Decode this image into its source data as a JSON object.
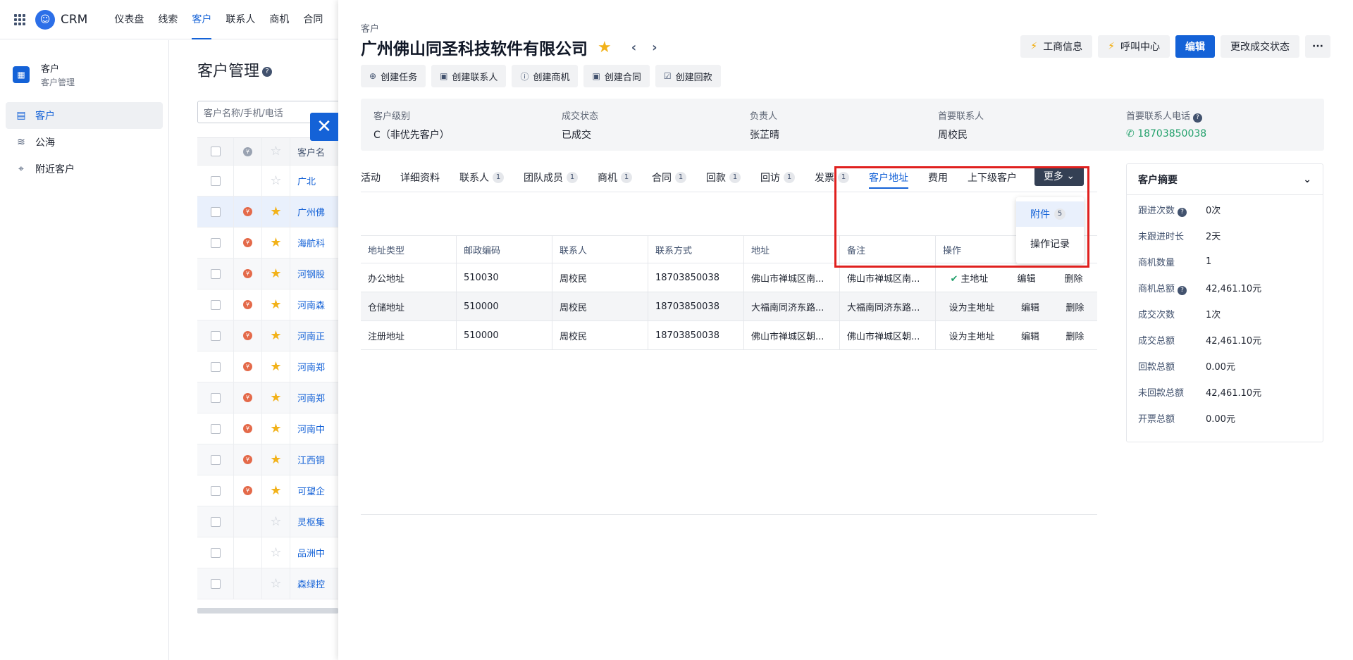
{
  "app": {
    "brand": "CRM"
  },
  "nav": [
    "仪表盘",
    "线索",
    "客户",
    "联系人",
    "商机",
    "合同"
  ],
  "sidebar": {
    "header_title": "客户",
    "header_sub": "客户管理",
    "items": [
      {
        "label": "客户",
        "icon": "building-icon"
      },
      {
        "label": "公海",
        "icon": "waves-icon"
      },
      {
        "label": "附近客户",
        "icon": "location-pin-icon"
      }
    ]
  },
  "list": {
    "title": "客户管理",
    "search_placeholder": "客户名称/手机/电话",
    "column_name": "客户名",
    "rows": [
      {
        "name": "广北",
        "rank": false,
        "star": false
      },
      {
        "name": "广州佛",
        "rank": true,
        "star": true
      },
      {
        "name": "海航科",
        "rank": true,
        "star": true
      },
      {
        "name": "河钢股",
        "rank": true,
        "star": true
      },
      {
        "name": "河南森",
        "rank": true,
        "star": true
      },
      {
        "name": "河南正",
        "rank": true,
        "star": true
      },
      {
        "name": "河南郑",
        "rank": true,
        "star": true
      },
      {
        "name": "河南郑",
        "rank": true,
        "star": true
      },
      {
        "name": "河南中",
        "rank": true,
        "star": true
      },
      {
        "name": "江西铜",
        "rank": true,
        "star": true
      },
      {
        "name": "可望企",
        "rank": true,
        "star": true
      },
      {
        "name": "灵枢集",
        "rank": false,
        "star": false
      },
      {
        "name": "品洲中",
        "rank": false,
        "star": false
      },
      {
        "name": "森绿控",
        "rank": false,
        "star": false
      }
    ]
  },
  "panel": {
    "breadcrumb": "客户",
    "company": "广州佛山同圣科技软件有限公司",
    "header_buttons": [
      {
        "label": "工商信息",
        "name": "business-info-button",
        "bolt": true
      },
      {
        "label": "呼叫中心",
        "name": "call-center-button",
        "bolt": true
      },
      {
        "label": "编辑",
        "name": "edit-button",
        "primary": true
      },
      {
        "label": "更改成交状态",
        "name": "change-deal-status-button"
      }
    ],
    "actions": [
      {
        "label": "创建任务",
        "icon": "plus-circle-icon",
        "glyph": "⊕"
      },
      {
        "label": "创建联系人",
        "icon": "clipboard-icon",
        "glyph": "▣"
      },
      {
        "label": "创建商机",
        "icon": "info-circle-icon",
        "glyph": "ⓘ"
      },
      {
        "label": "创建合同",
        "icon": "clipboard-icon",
        "glyph": "▣"
      },
      {
        "label": "创建回款",
        "icon": "clipboard-check-icon",
        "glyph": "☑"
      }
    ],
    "summary": [
      {
        "key": "客户级别",
        "value": "C（非优先客户）"
      },
      {
        "key": "成交状态",
        "value": "已成交"
      },
      {
        "key": "负责人",
        "value": "张芷晴"
      },
      {
        "key": "首要联系人",
        "value": "周校民"
      },
      {
        "key": "首要联系人电话",
        "value": "18703850038",
        "phone": true
      }
    ],
    "tabs": [
      {
        "label": "活动"
      },
      {
        "label": "详细资料"
      },
      {
        "label": "联系人",
        "count": "1"
      },
      {
        "label": "团队成员",
        "count": "1"
      },
      {
        "label": "商机",
        "count": "1"
      },
      {
        "label": "合同",
        "count": "1"
      },
      {
        "label": "回款",
        "count": "1"
      },
      {
        "label": "回访",
        "count": "1"
      },
      {
        "label": "发票",
        "count": "1"
      },
      {
        "label": "客户地址",
        "active": true
      },
      {
        "label": "费用"
      },
      {
        "label": "上下级客户"
      }
    ],
    "more_label": "更多",
    "dropdown": [
      {
        "label": "附件",
        "count": "5",
        "active": true
      },
      {
        "label": "操作记录"
      }
    ],
    "table": {
      "headers": [
        "地址类型",
        "邮政编码",
        "联系人",
        "联系方式",
        "地址",
        "备注",
        "操作"
      ],
      "rows": [
        {
          "type": "办公地址",
          "zip": "510030",
          "contact": "周校民",
          "phone": "18703850038",
          "address": "佛山市禅城区南...",
          "note": "佛山市禅城区南...",
          "main": "主地址",
          "is_main": true,
          "edit": "编辑",
          "delete": "删除"
        },
        {
          "type": "仓储地址",
          "zip": "510000",
          "contact": "周校民",
          "phone": "18703850038",
          "address": "大福南同济东路...",
          "note": "大福南同济东路...",
          "main": "设为主地址",
          "is_main": false,
          "edit": "编辑",
          "delete": "删除"
        },
        {
          "type": "注册地址",
          "zip": "510000",
          "contact": "周校民",
          "phone": "18703850038",
          "address": "佛山市禅城区朝...",
          "note": "佛山市禅城区朝...",
          "main": "设为主地址",
          "is_main": false,
          "edit": "编辑",
          "delete": "删除"
        }
      ]
    },
    "customer_summary": {
      "title": "客户摘要",
      "rows": [
        {
          "key": "跟进次数",
          "value": "0次",
          "help": true
        },
        {
          "key": "未跟进时长",
          "value": "2天"
        },
        {
          "key": "商机数量",
          "value": "1"
        },
        {
          "key": "商机总额",
          "value": "42,461.10元",
          "help": true
        },
        {
          "key": "成交次数",
          "value": "1次"
        },
        {
          "key": "成交总额",
          "value": "42,461.10元"
        },
        {
          "key": "回款总额",
          "value": "0.00元"
        },
        {
          "key": "未回款总额",
          "value": "42,461.10元"
        },
        {
          "key": "开票总额",
          "value": "0.00元"
        }
      ]
    }
  }
}
